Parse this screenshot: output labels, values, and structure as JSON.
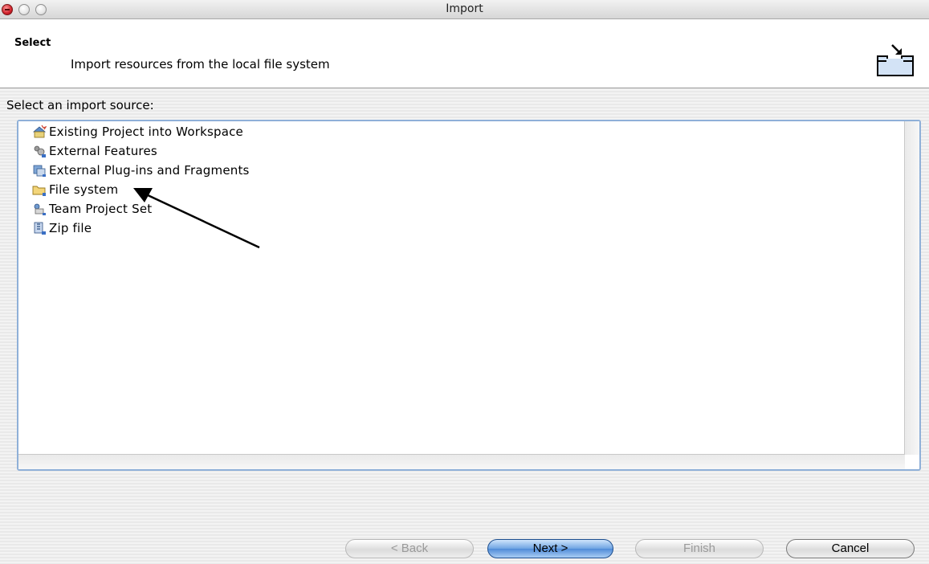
{
  "window": {
    "title": "Import"
  },
  "banner": {
    "title": "Select",
    "description": "Import resources from the local file system",
    "icon": "import-wizard-icon"
  },
  "source": {
    "label": "Select an import source:",
    "items": [
      {
        "label": "Existing Project into Workspace",
        "icon": "project-icon"
      },
      {
        "label": "External Features",
        "icon": "features-icon"
      },
      {
        "label": "External Plug-ins and Fragments",
        "icon": "plugins-icon"
      },
      {
        "label": "File system",
        "icon": "folder-icon"
      },
      {
        "label": "Team Project Set",
        "icon": "team-project-icon"
      },
      {
        "label": "Zip file",
        "icon": "zip-file-icon"
      }
    ]
  },
  "buttons": {
    "back": "< Back",
    "next": "Next >",
    "finish": "Finish",
    "cancel": "Cancel"
  },
  "colors": {
    "accent": "#5a96dc",
    "frame": "#8fb0d8"
  }
}
